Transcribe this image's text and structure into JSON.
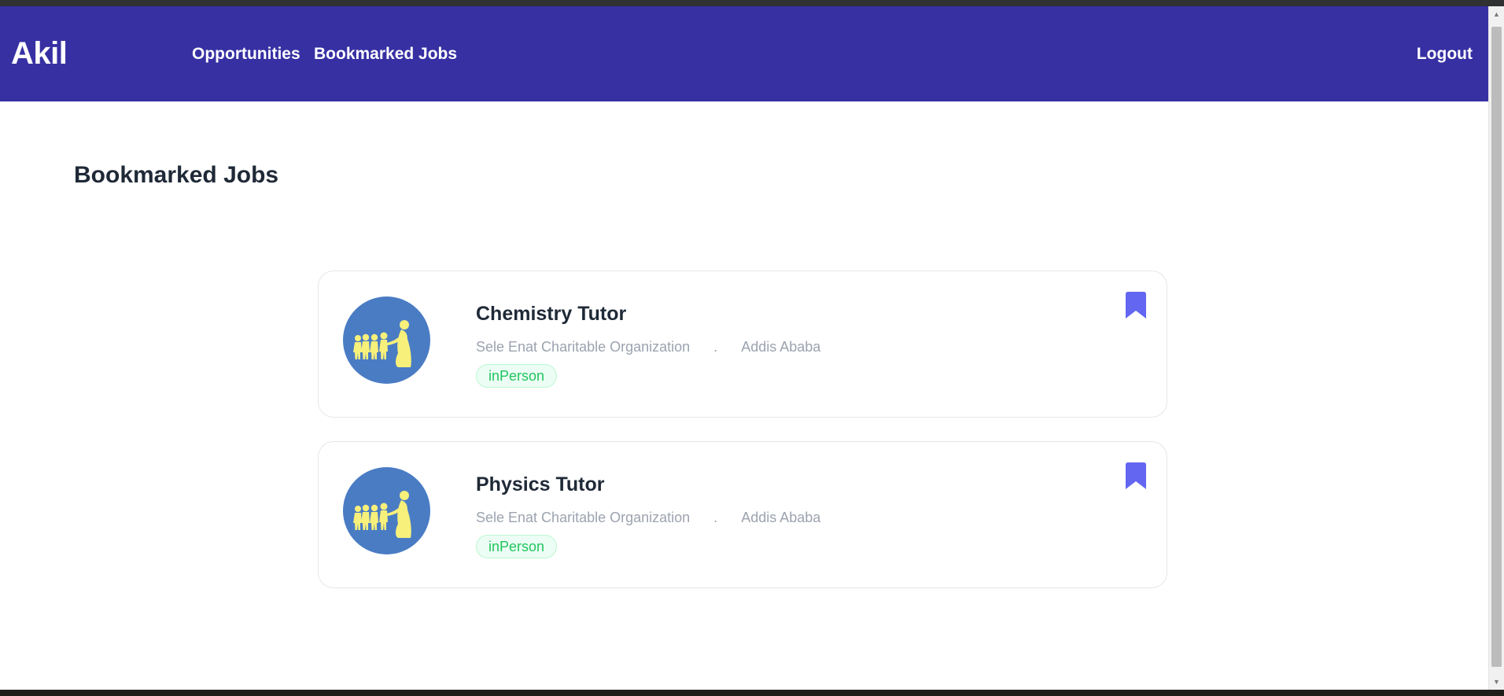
{
  "navbar": {
    "brand": "Akil",
    "links": [
      {
        "label": "Opportunities"
      },
      {
        "label": "Bookmarked Jobs"
      }
    ],
    "logout_label": "Logout"
  },
  "page": {
    "title": "Bookmarked Jobs"
  },
  "jobs": [
    {
      "title": "Chemistry Tutor",
      "organization": "Sele Enat Charitable Organization",
      "separator": ".",
      "location": "Addis Ababa",
      "tag": "inPerson",
      "logo_icon": "organization-logo",
      "bookmark_icon": "bookmark-filled-icon"
    },
    {
      "title": "Physics Tutor",
      "organization": "Sele Enat Charitable Organization",
      "separator": ".",
      "location": "Addis Ababa",
      "tag": "inPerson",
      "logo_icon": "organization-logo",
      "bookmark_icon": "bookmark-filled-icon"
    }
  ],
  "colors": {
    "navbar_bg": "#3730a3",
    "bookmark": "#6366f1",
    "tag_text": "#22c55e",
    "tag_bg": "#ecfdf5",
    "logo_bg": "#4a7cc4",
    "logo_figures": "#f7f07a"
  }
}
